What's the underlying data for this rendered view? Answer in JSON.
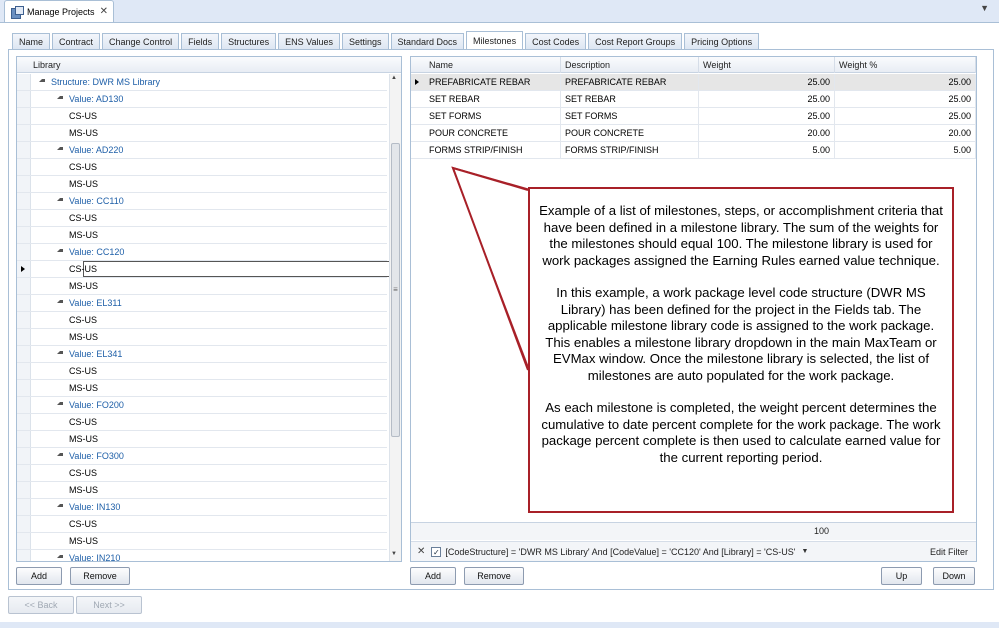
{
  "window": {
    "doc_tab": "Manage Projects"
  },
  "tabs": [
    "Name",
    "Contract",
    "Change Control",
    "Fields",
    "Structures",
    "ENS Values",
    "Settings",
    "Standard Docs",
    "Milestones",
    "Cost Codes",
    "Cost Report Groups",
    "Pricing Options"
  ],
  "active_tab": "Milestones",
  "library": {
    "header": "Library",
    "root": "Structure: DWR MS Library",
    "groups": [
      {
        "label": "Value: AD130",
        "children": [
          "CS-US",
          "MS-US"
        ]
      },
      {
        "label": "Value: AD220",
        "children": [
          "CS-US",
          "MS-US"
        ]
      },
      {
        "label": "Value: CC110",
        "children": [
          "CS-US",
          "MS-US"
        ]
      },
      {
        "label": "Value: CC120",
        "children": [
          "CS-US",
          "MS-US"
        ]
      },
      {
        "label": "Value: EL311",
        "children": [
          "CS-US",
          "MS-US"
        ]
      },
      {
        "label": "Value: EL341",
        "children": [
          "CS-US",
          "MS-US"
        ]
      },
      {
        "label": "Value: FO200",
        "children": [
          "CS-US",
          "MS-US"
        ]
      },
      {
        "label": "Value: FO300",
        "children": [
          "CS-US",
          "MS-US"
        ]
      },
      {
        "label": "Value: IN130",
        "children": [
          "CS-US",
          "MS-US"
        ]
      },
      {
        "label": "Value: IN210",
        "children": []
      }
    ],
    "add_label": "Add",
    "remove_label": "Remove"
  },
  "milestones": {
    "columns": [
      "Name",
      "Description",
      "Weight",
      "Weight %"
    ],
    "rows": [
      {
        "name": "PREFABRICATE REBAR",
        "description": "PREFABRICATE REBAR",
        "weight": "25.00",
        "weight_pct": "25.00"
      },
      {
        "name": "SET REBAR",
        "description": "SET REBAR",
        "weight": "25.00",
        "weight_pct": "25.00"
      },
      {
        "name": "SET FORMS",
        "description": "SET FORMS",
        "weight": "25.00",
        "weight_pct": "25.00"
      },
      {
        "name": "POUR CONCRETE",
        "description": "POUR CONCRETE",
        "weight": "20.00",
        "weight_pct": "20.00"
      },
      {
        "name": "FORMS STRIP/FINISH",
        "description": "FORMS STRIP/FINISH",
        "weight": "5.00",
        "weight_pct": "5.00"
      }
    ],
    "total_weight": "100",
    "filter": "[CodeStructure] = 'DWR MS Library' And [CodeValue] = 'CC120' And [Library] = 'CS-US'",
    "edit_filter_label": "Edit Filter",
    "add_label": "Add",
    "remove_label": "Remove",
    "up_label": "Up",
    "down_label": "Down"
  },
  "wizard": {
    "back_label": "<< Back",
    "next_label": "Next >>"
  },
  "callout": {
    "paragraphs": [
      "Example of a list of milestones, steps, or accomplishment criteria that have been defined in a milestone library. The sum of the weights for the milestones should equal 100. The milestone library is used for work packages assigned the Earning Rules earned value technique.",
      "In this example, a work package level code structure (DWR MS Library) has been defined for the project in the Fields tab. The applicable milestone library code is assigned to the work package. This enables a milestone library dropdown in the main MaxTeam or EVMax window. Once the milestone library is selected, the list of milestones are auto populated for the work package.",
      "As each milestone is completed, the weight percent determines the cumulative to date percent complete for the work package. The work package percent complete is then used to calculate earned value for the current reporting period."
    ]
  },
  "colors": {
    "accent": "#1e5fa8",
    "callout_border": "#a82028",
    "chrome": "#dfe8f6"
  }
}
